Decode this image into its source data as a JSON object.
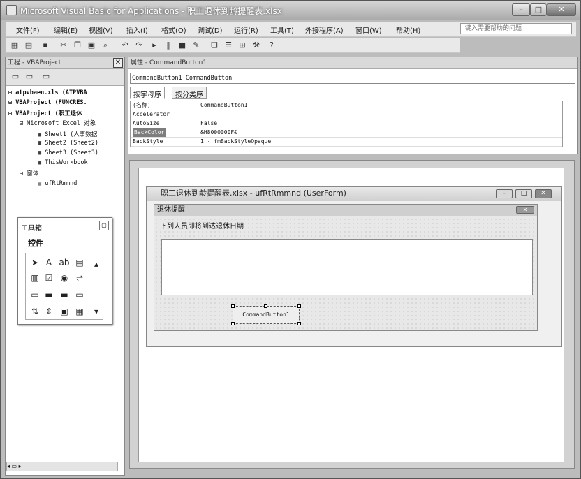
{
  "window": {
    "title": "Microsoft Visual Basic for Applications - 职工退休到龄提醒表.xlsx"
  },
  "menu": {
    "items": [
      "文件(F)",
      "编辑(E)",
      "视图(V)",
      "插入(I)",
      "格式(O)",
      "调试(D)",
      "运行(R)",
      "工具(T)",
      "外接程序(A)",
      "窗口(W)",
      "帮助(H)"
    ],
    "help_placeholder": "键入需要帮助的问题"
  },
  "project": {
    "title": "工程 - VBAProject",
    "items": [
      {
        "label": "atpvbaen.xls (ATPVBA",
        "bold": true
      },
      {
        "label": "VBAProject (FUNCRES.",
        "bold": true
      },
      {
        "label": "VBAProject (职工退休",
        "bold": true
      },
      {
        "label": "Microsoft Excel 对象",
        "bold": false
      },
      {
        "label": "Sheet1 (人事数据",
        "bold": false
      },
      {
        "label": "Sheet2 (Sheet2)",
        "bold": false
      },
      {
        "label": "Sheet3 (Sheet3)",
        "bold": false
      },
      {
        "label": "ThisWorkbook",
        "bold": false
      },
      {
        "label": "窗体",
        "bold": false
      },
      {
        "label": "ufRtRmmnd",
        "bold": false
      }
    ]
  },
  "properties": {
    "title": "属性 - CommandButton1",
    "object": "CommandButton1 CommandButton",
    "tabs": [
      "按字母序",
      "按分类序"
    ],
    "rows": [
      {
        "key": "(名称)",
        "value": "CommandButton1"
      },
      {
        "key": "Accelerator",
        "value": ""
      },
      {
        "key": "AutoSize",
        "value": "False"
      },
      {
        "key": "BackColor",
        "value": "&H8000000F&"
      },
      {
        "key": "BackStyle",
        "value": "1 - fmBackStyleOpaque"
      }
    ]
  },
  "userform": {
    "title": "职工退休到龄提醒表.xlsx - ufRtRmmnd (UserForm)",
    "caption": "退休提醒",
    "label": "下列人员即将到达退休日期",
    "button": "CommandButton1"
  },
  "toolbox": {
    "title": "工具箱",
    "tab": "控件"
  }
}
